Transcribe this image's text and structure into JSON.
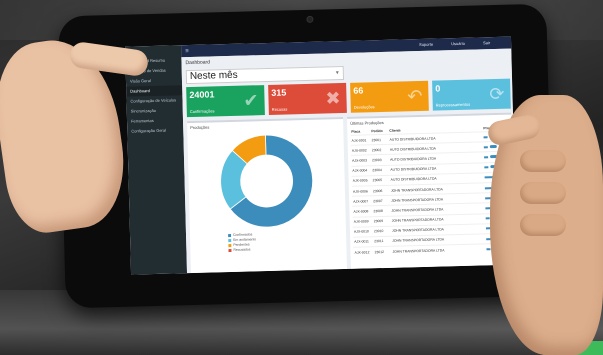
{
  "sidebar": {
    "items": [
      {
        "label": "Dashboard Resumo"
      },
      {
        "label": "Relatório de Vendas"
      },
      {
        "label": "Visão Geral"
      },
      {
        "label": "Dashboard"
      },
      {
        "label": "Configuração de Veículos"
      },
      {
        "label": "Sincronização"
      },
      {
        "label": "Ferramentas"
      },
      {
        "label": "Configuração Geral"
      }
    ]
  },
  "topbar": {
    "menu_icon": "menu-icon",
    "items": [
      "Suporte",
      "Usuário",
      "Sair"
    ]
  },
  "header": {
    "title": "Dashboard",
    "period": "Neste mês"
  },
  "tiles": [
    {
      "value": "24001",
      "label": "Confirmações",
      "color": "#1aa35f",
      "icon": "check-icon"
    },
    {
      "value": "315",
      "label": "Recusas",
      "color": "#dd4b39",
      "icon": "close-icon"
    },
    {
      "value": "66",
      "label": "Devoluções",
      "color": "#f39c12",
      "icon": "reply-icon"
    },
    {
      "value": "0",
      "label": "Reprocessamentos",
      "color": "#5bc0de",
      "icon": "refresh-icon"
    }
  ],
  "left_panel": {
    "title": "Produções",
    "donut": [
      {
        "label": "Confirmados",
        "value": 0.65,
        "color": "#3c8dbc"
      },
      {
        "label": "Em andamento",
        "value": 0.22,
        "color": "#5bc0de"
      },
      {
        "label": "Pendentes",
        "value": 0.13,
        "color": "#f39c12"
      }
    ],
    "legend": [
      "Confirmados",
      "Em andamento",
      "Pendentes",
      "Recusados"
    ]
  },
  "right_panel": {
    "title": "Últimas Produções",
    "columns": [
      "Placa",
      "Pedido",
      "Cliente",
      "Progresso"
    ],
    "rows": [
      {
        "placa": "AJX-0001",
        "pedido": "23001",
        "cliente": "AUTO DISTRIBUIDORA LTDA",
        "progress": 0.3
      },
      {
        "placa": "AJX-0002",
        "pedido": "23002",
        "cliente": "AUTO DISTRIBUIDORA LTDA",
        "progress": 0.3
      },
      {
        "placa": "AJX-0003",
        "pedido": "23003",
        "cliente": "AUTO DISTRIBUIDORA LTDA",
        "progress": 0.3
      },
      {
        "placa": "AJX-0004",
        "pedido": "23004",
        "cliente": "AUTO DISTRIBUIDORA LTDA",
        "progress": 0.3
      },
      {
        "placa": "AJX-0005",
        "pedido": "23005",
        "cliente": "AUTO DISTRIBUIDORA LTDA",
        "progress": 0.7
      },
      {
        "placa": "AJX-0006",
        "pedido": "23006",
        "cliente": "JOHN TRANSPORTADORA LTDA",
        "progress": 0.5
      },
      {
        "placa": "AJX-0007",
        "pedido": "23007",
        "cliente": "JOHN TRANSPORTADORA LTDA",
        "progress": 0.6
      },
      {
        "placa": "AJX-0008",
        "pedido": "23008",
        "cliente": "JOHN TRANSPORTADORA LTDA",
        "progress": 0.5
      },
      {
        "placa": "AJX-0009",
        "pedido": "23009",
        "cliente": "JOHN TRANSPORTADORA LTDA",
        "progress": 0.3
      },
      {
        "placa": "AJX-0010",
        "pedido": "23010",
        "cliente": "JOHN TRANSPORTADORA LTDA",
        "progress": 0.6
      },
      {
        "placa": "AJX-0011",
        "pedido": "23011",
        "cliente": "JOHN TRANSPORTADORA LTDA",
        "progress": 0.7
      },
      {
        "placa": "AJX-0012",
        "pedido": "23012",
        "cliente": "JOHN TRANSPORTADORA LTDA",
        "progress": 0.3
      }
    ]
  }
}
